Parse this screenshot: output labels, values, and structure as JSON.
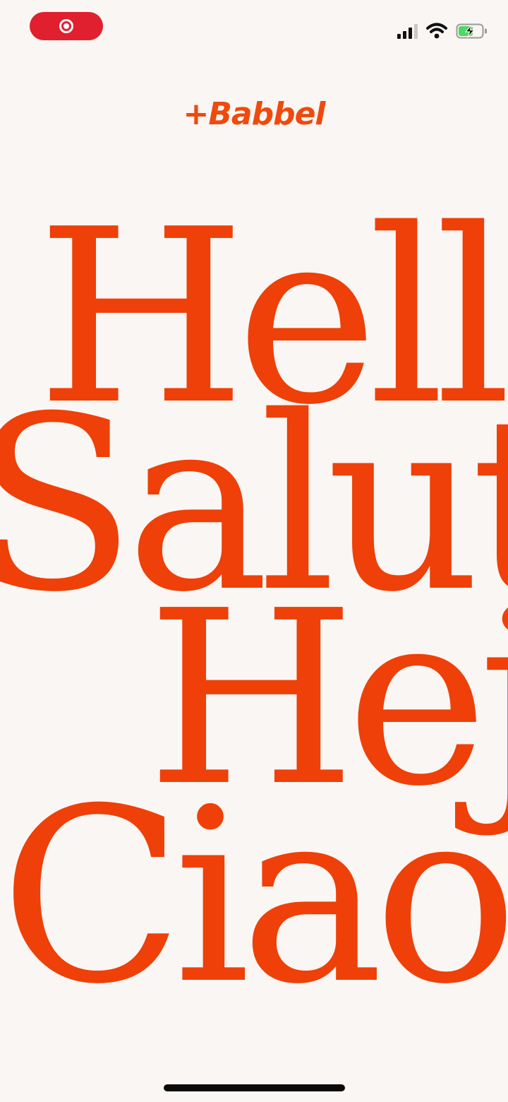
{
  "status_bar": {
    "record_icon": "screen-record-icon",
    "signal_icon": "cellular-signal-icon",
    "wifi_icon": "wifi-icon",
    "battery_icon": "battery-charging-icon",
    "record_color": "#e0202f",
    "battery_fill_color": "#4cd964"
  },
  "brand": {
    "logo_text": "+Babbel",
    "color": "#ee4a0d"
  },
  "greetings": {
    "words": [
      "Hello",
      "Salut",
      "Hej",
      "Ciao"
    ],
    "color": "#ee4008"
  },
  "background_color": "#faf6f3"
}
